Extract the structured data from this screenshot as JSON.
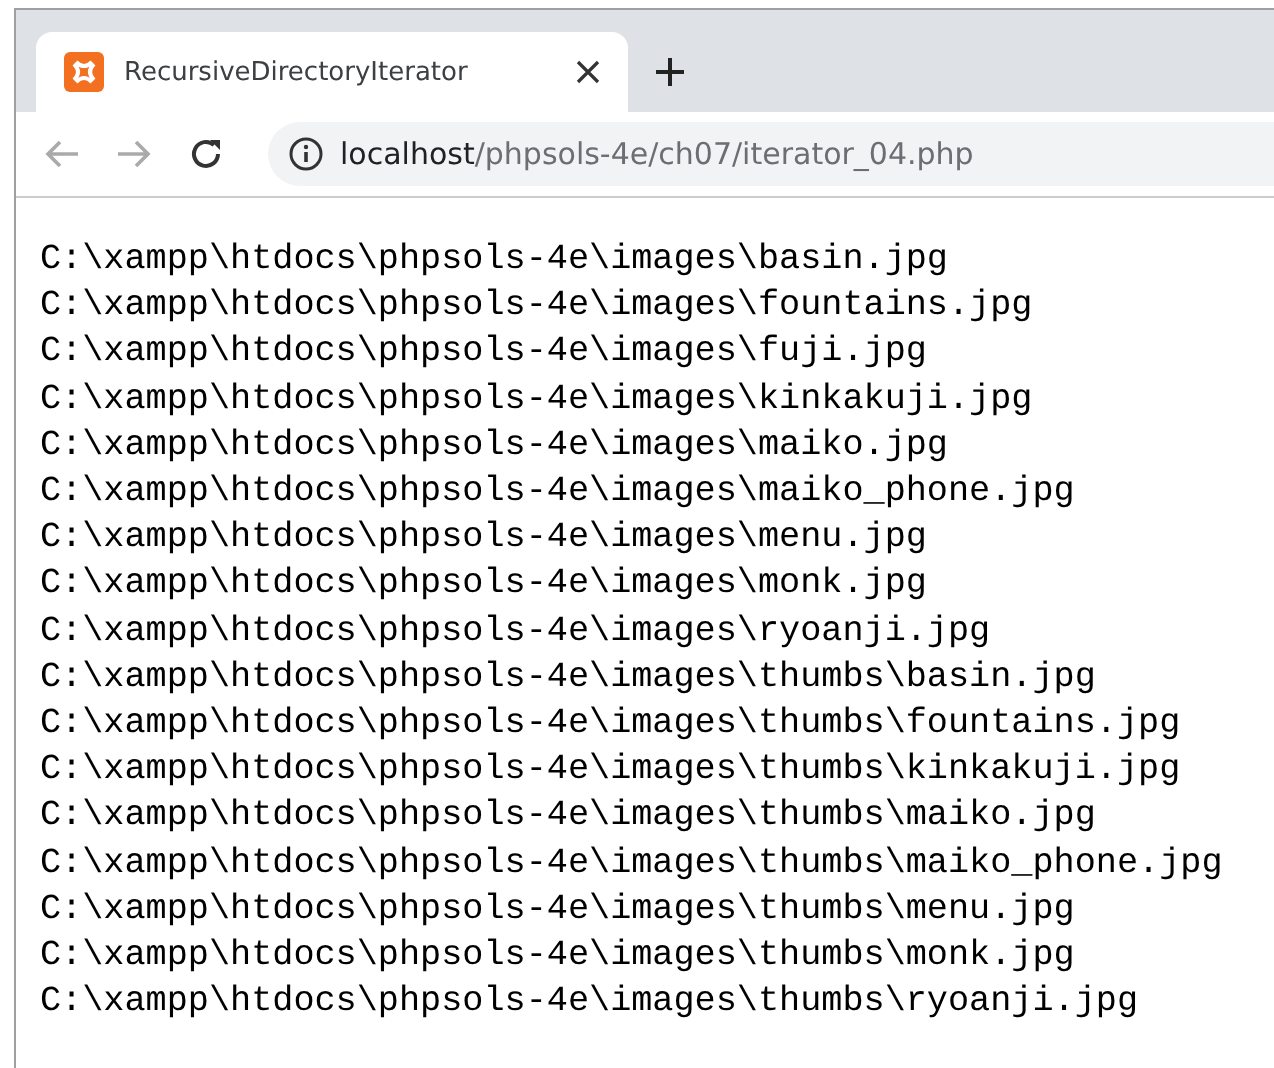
{
  "tab": {
    "title": "RecursiveDirectoryIterator",
    "selected": true
  },
  "address": {
    "host": "localhost",
    "path": "/phpsols-4e/ch07/iterator_04.php"
  },
  "lines": [
    "C:\\xampp\\htdocs\\phpsols-4e\\images\\basin.jpg",
    "C:\\xampp\\htdocs\\phpsols-4e\\images\\fountains.jpg",
    "C:\\xampp\\htdocs\\phpsols-4e\\images\\fuji.jpg",
    "C:\\xampp\\htdocs\\phpsols-4e\\images\\kinkakuji.jpg",
    "C:\\xampp\\htdocs\\phpsols-4e\\images\\maiko.jpg",
    "C:\\xampp\\htdocs\\phpsols-4e\\images\\maiko_phone.jpg",
    "C:\\xampp\\htdocs\\phpsols-4e\\images\\menu.jpg",
    "C:\\xampp\\htdocs\\phpsols-4e\\images\\monk.jpg",
    "C:\\xampp\\htdocs\\phpsols-4e\\images\\ryoanji.jpg",
    "C:\\xampp\\htdocs\\phpsols-4e\\images\\thumbs\\basin.jpg",
    "C:\\xampp\\htdocs\\phpsols-4e\\images\\thumbs\\fountains.jpg",
    "C:\\xampp\\htdocs\\phpsols-4e\\images\\thumbs\\kinkakuji.jpg",
    "C:\\xampp\\htdocs\\phpsols-4e\\images\\thumbs\\maiko.jpg",
    "C:\\xampp\\htdocs\\phpsols-4e\\images\\thumbs\\maiko_phone.jpg",
    "C:\\xampp\\htdocs\\phpsols-4e\\images\\thumbs\\menu.jpg",
    "C:\\xampp\\htdocs\\phpsols-4e\\images\\thumbs\\monk.jpg",
    "C:\\xampp\\htdocs\\phpsols-4e\\images\\thumbs\\ryoanji.jpg"
  ]
}
